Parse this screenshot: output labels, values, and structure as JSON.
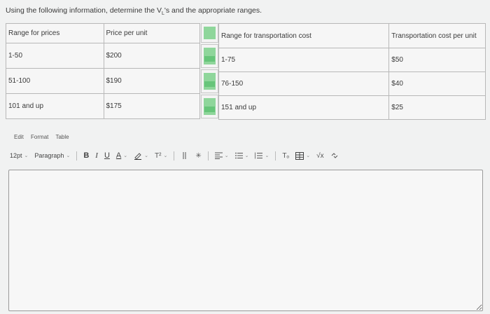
{
  "question": {
    "pre": "Using the following information, determine the V",
    "sub": "L",
    "post": "'s and the appropriate ranges."
  },
  "price_table": {
    "headers": [
      "Range for prices",
      "Price per unit"
    ],
    "rows": [
      [
        "1-50",
        "$200"
      ],
      [
        "51-100",
        "$190"
      ],
      [
        "101 and up",
        "$175"
      ]
    ]
  },
  "transport_table": {
    "headers": [
      "Range for transportation cost",
      "Transportation cost per unit"
    ],
    "rows": [
      [
        "1-75",
        "$50"
      ],
      [
        "76-150",
        "$40"
      ],
      [
        "151 and up",
        "$25"
      ]
    ]
  },
  "menubar": {
    "edit": "Edit",
    "format": "Format",
    "table": "Table"
  },
  "toolbar": {
    "font_size": "12pt",
    "block_format": "Paragraph",
    "bold": "B",
    "italic": "I",
    "underline": "U",
    "text_color": "A",
    "superscript": "T²",
    "clear_format": "Tₒ",
    "sqrt": "√x"
  },
  "colors": {
    "green_marker": "#8fd69b",
    "border": "#b8b8b8"
  },
  "editor": {
    "value": ""
  }
}
